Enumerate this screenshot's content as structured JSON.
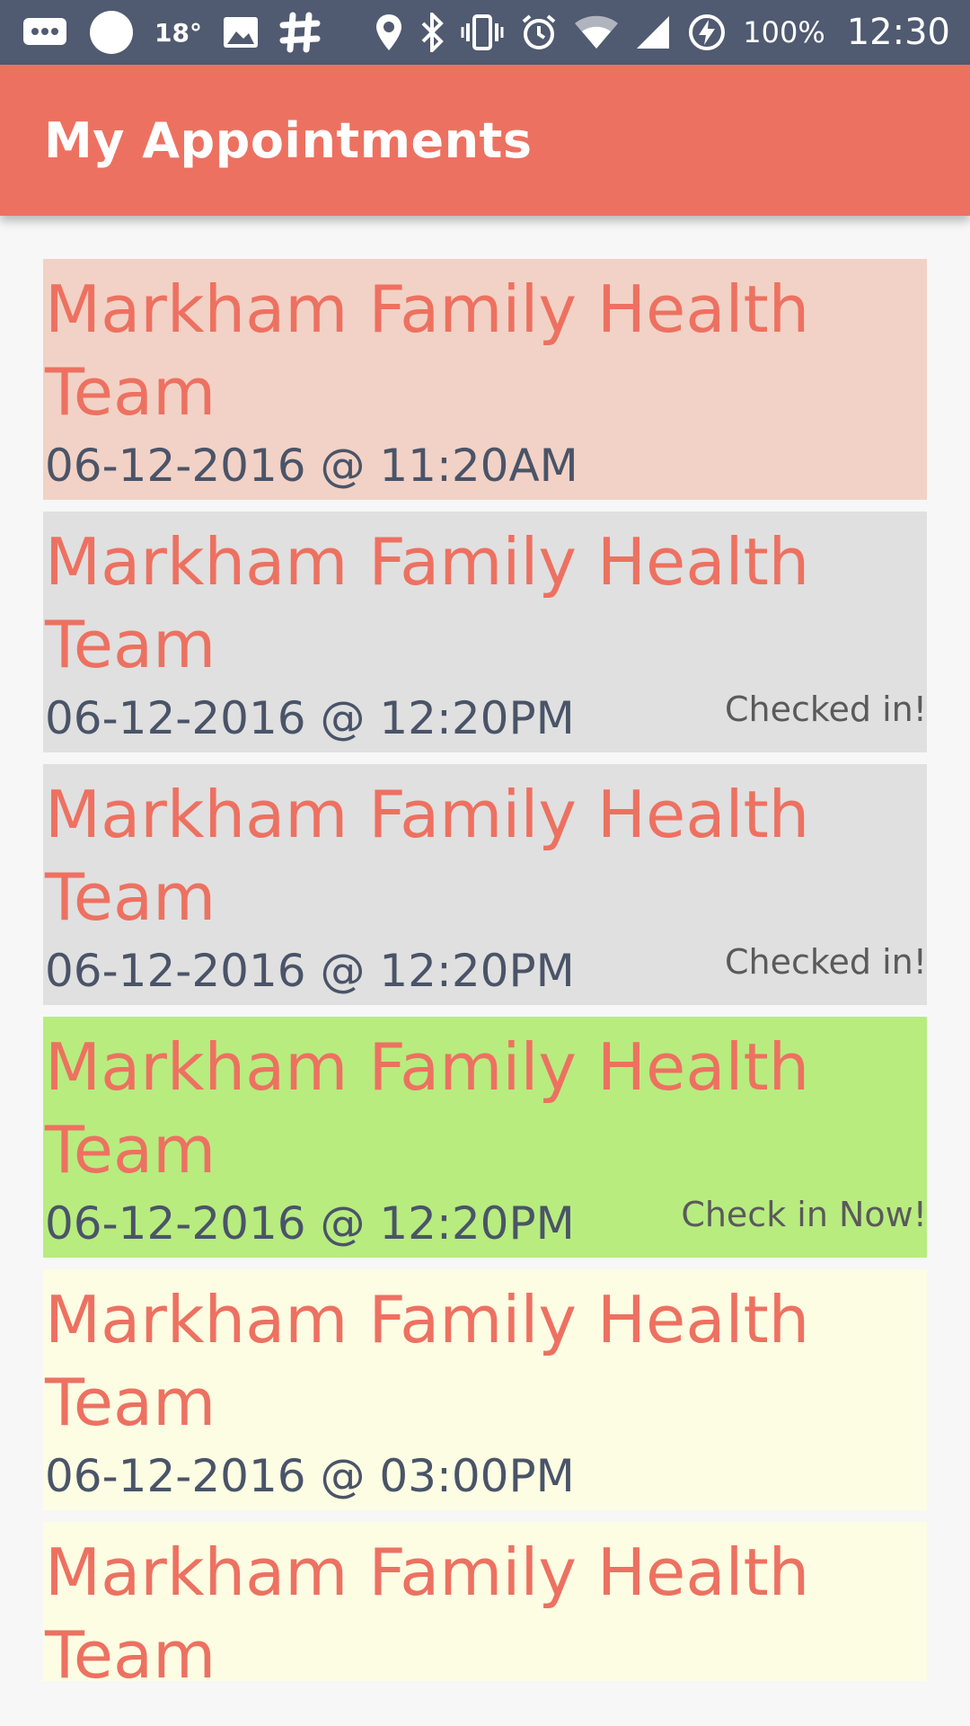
{
  "status_bar": {
    "left_icons": [
      "message-icon",
      "circle-icon"
    ],
    "temperature": "18°",
    "left_icons_after": [
      "image-icon",
      "slack-icon"
    ],
    "right_icons": [
      "location-icon",
      "bluetooth-icon",
      "vibrate-icon",
      "alarm-icon",
      "wifi-icon",
      "signal-icon",
      "battery-saver-icon"
    ],
    "battery": "100%",
    "time": "12:30"
  },
  "app_bar": {
    "title": "My Appointments"
  },
  "appointments": [
    {
      "name": "Markham Family Health Team",
      "datetime": "06-12-2016 @ 11:20AM",
      "status": "",
      "bg": "#f2d2c6"
    },
    {
      "name": "Markham Family Health Team",
      "datetime": "06-12-2016 @ 12:20PM",
      "status": "Checked in!",
      "bg": "#e0e0e0"
    },
    {
      "name": "Markham Family Health Team",
      "datetime": "06-12-2016 @ 12:20PM",
      "status": "Checked in!",
      "bg": "#e0e0e0"
    },
    {
      "name": "Markham Family Health Team",
      "datetime": "06-12-2016 @ 12:20PM",
      "status": "Check in Now!",
      "bg": "#b8ec7f"
    },
    {
      "name": "Markham Family Health Team",
      "datetime": "06-12-2016 @ 03:00PM",
      "status": "",
      "bg": "#fdfde4"
    },
    {
      "name": "Markham Family Health Team",
      "datetime": "",
      "status": "",
      "bg": "#fdfde4"
    }
  ],
  "colors": {
    "accent": "#ed7161",
    "status_bar": "#505a70"
  }
}
